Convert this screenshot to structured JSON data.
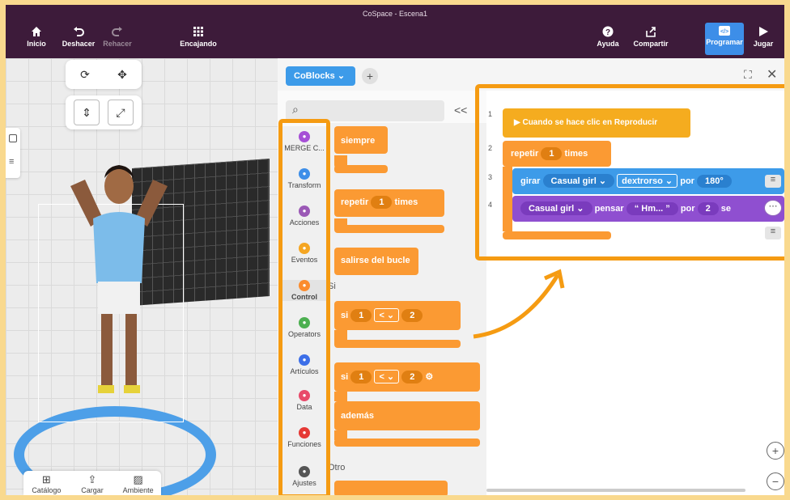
{
  "window_title": "CoSpace - Escena1",
  "toolbar": {
    "inicio": "Inicio",
    "deshacer": "Deshacer",
    "rehacer": "Rehacer",
    "encajando": "Encajando",
    "ayuda": "Ayuda",
    "compartir": "Compartir",
    "programar": "Programar",
    "jugar": "Jugar"
  },
  "bottom": {
    "catalogo": "Catálogo",
    "cargar": "Cargar",
    "ambiente": "Ambiente"
  },
  "editor": {
    "tab": "CoBlocks",
    "collapse": "<<"
  },
  "categories": [
    {
      "label": "MERGE C...",
      "color": "#a64fd6"
    },
    {
      "label": "Transform",
      "color": "#3d8ee8"
    },
    {
      "label": "Acciones",
      "color": "#9b59b6"
    },
    {
      "label": "Eventos",
      "color": "#f5a623"
    },
    {
      "label": "Control",
      "color": "#fb8c2e"
    },
    {
      "label": "Operators",
      "color": "#4caf50"
    },
    {
      "label": "Artículos",
      "color": "#3d6fe8"
    },
    {
      "label": "Data",
      "color": "#e84a6a"
    },
    {
      "label": "Funciones",
      "color": "#e53935"
    },
    {
      "label": "Ajustes",
      "color": "#555555"
    }
  ],
  "palette": {
    "siempre": "siempre",
    "repetir": "repetir",
    "times": "times",
    "num1": "1",
    "salirse": "salirse del bucle",
    "group_si": "Si",
    "si": "si",
    "lt": "<",
    "num2": "2",
    "ademas": "además",
    "group_otro": "Otro"
  },
  "script": {
    "line_nums": [
      "1",
      "2",
      "3",
      "4"
    ],
    "event": "▶ Cuando se hace clic en Reproducir",
    "repetir": "repetir",
    "rep_count": "1",
    "times": "times",
    "girar": "girar",
    "girar_obj": "Casual girl",
    "direction": "dextrorso",
    "por": "por",
    "angle": "180°",
    "pensar_obj": "Casual girl",
    "pensar": "pensar",
    "thought": "“ Hm... ”",
    "por2": "por",
    "secs": "2",
    "sec_suffix": "se"
  }
}
